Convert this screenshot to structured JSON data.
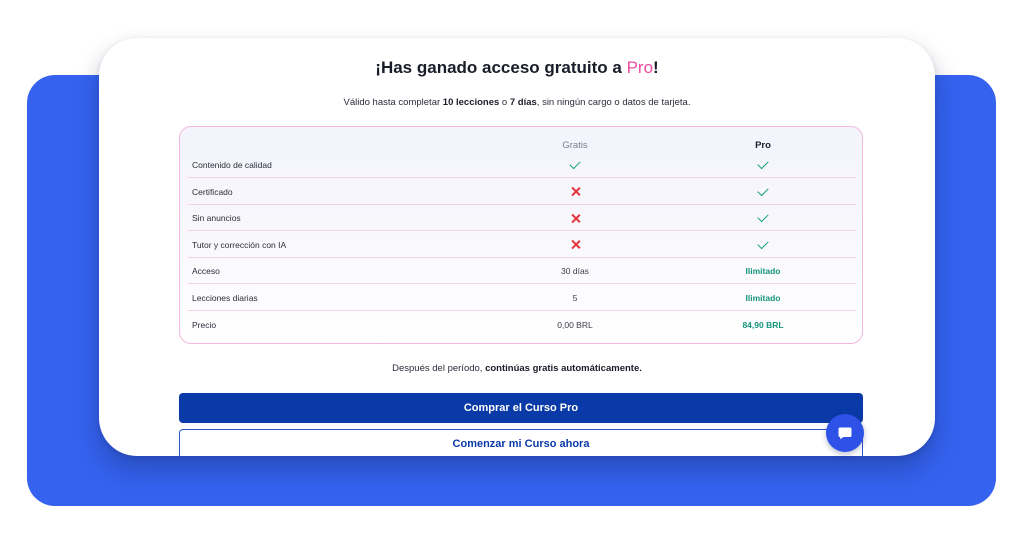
{
  "modal": {
    "title_prefix": "¡Has ganado acceso gratuito a ",
    "title_highlight": "Pro",
    "title_suffix": "!",
    "subtitle_prefix": "Válido hasta completar ",
    "subtitle_lessons": "10 lecciones",
    "subtitle_or": " o ",
    "subtitle_days": "7 días",
    "subtitle_suffix": ", sin ningún cargo o datos de tarjeta."
  },
  "comparison": {
    "columns": {
      "gratis": "Gratis",
      "pro": "Pro"
    },
    "rows": [
      {
        "label": "Contenido de calidad",
        "gratis": {
          "type": "check"
        },
        "pro": {
          "type": "check"
        }
      },
      {
        "label": "Certificado",
        "gratis": {
          "type": "cross"
        },
        "pro": {
          "type": "check"
        }
      },
      {
        "label": "Sin anuncios",
        "gratis": {
          "type": "cross"
        },
        "pro": {
          "type": "check"
        }
      },
      {
        "label": "Tutor y corrección con IA",
        "gratis": {
          "type": "cross"
        },
        "pro": {
          "type": "check"
        }
      },
      {
        "label": "Acceso",
        "gratis": {
          "type": "text",
          "value": "30 días"
        },
        "pro": {
          "type": "text",
          "value": "Ilimitado",
          "highlight": true
        }
      },
      {
        "label": "Lecciones diarias",
        "gratis": {
          "type": "text",
          "value": "5"
        },
        "pro": {
          "type": "text",
          "value": "Ilimitado",
          "highlight": true
        }
      },
      {
        "label": "Precio",
        "gratis": {
          "type": "text",
          "value": "0,00 BRL"
        },
        "pro": {
          "type": "text",
          "value": "84,90 BRL",
          "highlight": true
        }
      }
    ],
    "icons": {
      "check": "check-icon",
      "cross": "cross-icon"
    }
  },
  "footer_note": {
    "prefix": "Después del período, ",
    "bold": "continúas gratis automáticamente."
  },
  "buttons": {
    "primary": "Comprar el Curso Pro",
    "secondary": "Comenzar mi Curso ahora"
  },
  "chat": {
    "icon": "chat-bubble-icon"
  },
  "colors": {
    "accent_pink": "#ee4aa0",
    "primary_blue": "#0a3aa8",
    "backdrop_blue": "#3563f0",
    "check_green": "#18a27f",
    "cross_red": "#e3353d",
    "highlight_green": "#14957a"
  }
}
